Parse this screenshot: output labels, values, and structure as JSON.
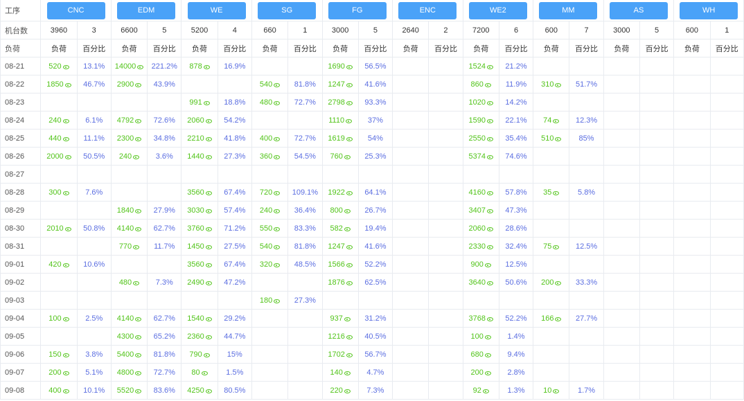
{
  "corner_label": "工序",
  "machines_label": "机台数",
  "load_label": "负荷",
  "sub_load": "负荷",
  "sub_pct": "百分比",
  "processes": [
    {
      "name": "CNC",
      "machines": "3960",
      "count": "3"
    },
    {
      "name": "EDM",
      "machines": "6600",
      "count": "5"
    },
    {
      "name": "WE",
      "machines": "5200",
      "count": "4"
    },
    {
      "name": "SG",
      "machines": "660",
      "count": "1"
    },
    {
      "name": "FG",
      "machines": "3000",
      "count": "5"
    },
    {
      "name": "ENC",
      "machines": "2640",
      "count": "2"
    },
    {
      "name": "WE2",
      "machines": "7200",
      "count": "6"
    },
    {
      "name": "MM",
      "machines": "600",
      "count": "7"
    },
    {
      "name": "AS",
      "machines": "3000",
      "count": "5"
    },
    {
      "name": "WH",
      "machines": "600",
      "count": "1"
    }
  ],
  "rows": [
    {
      "date": "08-21",
      "cells": [
        [
          "520",
          "13.1%"
        ],
        [
          "14000",
          "221.2%"
        ],
        [
          "878",
          "16.9%"
        ],
        [
          "",
          ""
        ],
        [
          "1690",
          "56.5%"
        ],
        [
          "",
          ""
        ],
        [
          "1524",
          "21.2%"
        ],
        [
          "",
          ""
        ],
        [
          "",
          ""
        ],
        [
          "",
          ""
        ]
      ]
    },
    {
      "date": "08-22",
      "cells": [
        [
          "1850",
          "46.7%"
        ],
        [
          "2900",
          "43.9%"
        ],
        [
          "",
          ""
        ],
        [
          "540",
          "81.8%"
        ],
        [
          "1247",
          "41.6%"
        ],
        [
          "",
          ""
        ],
        [
          "860",
          "11.9%"
        ],
        [
          "310",
          "51.7%"
        ],
        [
          "",
          ""
        ],
        [
          "",
          ""
        ]
      ]
    },
    {
      "date": "08-23",
      "cells": [
        [
          "",
          ""
        ],
        [
          "",
          ""
        ],
        [
          "991",
          "18.8%"
        ],
        [
          "480",
          "72.7%"
        ],
        [
          "2798",
          "93.3%"
        ],
        [
          "",
          ""
        ],
        [
          "1020",
          "14.2%"
        ],
        [
          "",
          ""
        ],
        [
          "",
          ""
        ],
        [
          "",
          ""
        ]
      ]
    },
    {
      "date": "08-24",
      "cells": [
        [
          "240",
          "6.1%"
        ],
        [
          "4792",
          "72.6%"
        ],
        [
          "2060",
          "54.2%"
        ],
        [
          "",
          ""
        ],
        [
          "1110",
          "37%"
        ],
        [
          "",
          ""
        ],
        [
          "1590",
          "22.1%"
        ],
        [
          "74",
          "12.3%"
        ],
        [
          "",
          ""
        ],
        [
          "",
          ""
        ]
      ]
    },
    {
      "date": "08-25",
      "cells": [
        [
          "440",
          "11.1%"
        ],
        [
          "2300",
          "34.8%"
        ],
        [
          "2210",
          "41.8%"
        ],
        [
          "400",
          "72.7%"
        ],
        [
          "1619",
          "54%"
        ],
        [
          "",
          ""
        ],
        [
          "2550",
          "35.4%"
        ],
        [
          "510",
          "85%"
        ],
        [
          "",
          ""
        ],
        [
          "",
          ""
        ]
      ]
    },
    {
      "date": "08-26",
      "cells": [
        [
          "2000",
          "50.5%"
        ],
        [
          "240",
          "3.6%"
        ],
        [
          "1440",
          "27.3%"
        ],
        [
          "360",
          "54.5%"
        ],
        [
          "760",
          "25.3%"
        ],
        [
          "",
          ""
        ],
        [
          "5374",
          "74.6%"
        ],
        [
          "",
          ""
        ],
        [
          "",
          ""
        ],
        [
          "",
          ""
        ]
      ]
    },
    {
      "date": "08-27",
      "cells": [
        [
          "",
          ""
        ],
        [
          "",
          ""
        ],
        [
          "",
          ""
        ],
        [
          "",
          ""
        ],
        [
          "",
          ""
        ],
        [
          "",
          ""
        ],
        [
          "",
          ""
        ],
        [
          "",
          ""
        ],
        [
          "",
          ""
        ],
        [
          "",
          ""
        ]
      ]
    },
    {
      "date": "08-28",
      "cells": [
        [
          "300",
          "7.6%"
        ],
        [
          "",
          ""
        ],
        [
          "3560",
          "67.4%"
        ],
        [
          "720",
          "109.1%"
        ],
        [
          "1922",
          "64.1%"
        ],
        [
          "",
          ""
        ],
        [
          "4160",
          "57.8%"
        ],
        [
          "35",
          "5.8%"
        ],
        [
          "",
          ""
        ],
        [
          "",
          ""
        ]
      ]
    },
    {
      "date": "08-29",
      "cells": [
        [
          "",
          ""
        ],
        [
          "1840",
          "27.9%"
        ],
        [
          "3030",
          "57.4%"
        ],
        [
          "240",
          "36.4%"
        ],
        [
          "800",
          "26.7%"
        ],
        [
          "",
          ""
        ],
        [
          "3407",
          "47.3%"
        ],
        [
          "",
          ""
        ],
        [
          "",
          ""
        ],
        [
          "",
          ""
        ]
      ]
    },
    {
      "date": "08-30",
      "cells": [
        [
          "2010",
          "50.8%"
        ],
        [
          "4140",
          "62.7%"
        ],
        [
          "3760",
          "71.2%"
        ],
        [
          "550",
          "83.3%"
        ],
        [
          "582",
          "19.4%"
        ],
        [
          "",
          ""
        ],
        [
          "2060",
          "28.6%"
        ],
        [
          "",
          ""
        ],
        [
          "",
          ""
        ],
        [
          "",
          ""
        ]
      ]
    },
    {
      "date": "08-31",
      "cells": [
        [
          "",
          ""
        ],
        [
          "770",
          "11.7%"
        ],
        [
          "1450",
          "27.5%"
        ],
        [
          "540",
          "81.8%"
        ],
        [
          "1247",
          "41.6%"
        ],
        [
          "",
          ""
        ],
        [
          "2330",
          "32.4%"
        ],
        [
          "75",
          "12.5%"
        ],
        [
          "",
          ""
        ],
        [
          "",
          ""
        ]
      ]
    },
    {
      "date": "09-01",
      "cells": [
        [
          "420",
          "10.6%"
        ],
        [
          "",
          ""
        ],
        [
          "3560",
          "67.4%"
        ],
        [
          "320",
          "48.5%"
        ],
        [
          "1566",
          "52.2%"
        ],
        [
          "",
          ""
        ],
        [
          "900",
          "12.5%"
        ],
        [
          "",
          ""
        ],
        [
          "",
          ""
        ],
        [
          "",
          ""
        ]
      ]
    },
    {
      "date": "09-02",
      "cells": [
        [
          "",
          ""
        ],
        [
          "480",
          "7.3%"
        ],
        [
          "2490",
          "47.2%"
        ],
        [
          "",
          ""
        ],
        [
          "1876",
          "62.5%"
        ],
        [
          "",
          ""
        ],
        [
          "3640",
          "50.6%"
        ],
        [
          "200",
          "33.3%"
        ],
        [
          "",
          ""
        ],
        [
          "",
          ""
        ]
      ]
    },
    {
      "date": "09-03",
      "cells": [
        [
          "",
          ""
        ],
        [
          "",
          ""
        ],
        [
          "",
          ""
        ],
        [
          "180",
          "27.3%"
        ],
        [
          "",
          ""
        ],
        [
          "",
          ""
        ],
        [
          "",
          ""
        ],
        [
          "",
          ""
        ],
        [
          "",
          ""
        ],
        [
          "",
          ""
        ]
      ]
    },
    {
      "date": "09-04",
      "cells": [
        [
          "100",
          "2.5%"
        ],
        [
          "4140",
          "62.7%"
        ],
        [
          "1540",
          "29.2%"
        ],
        [
          "",
          ""
        ],
        [
          "937",
          "31.2%"
        ],
        [
          "",
          ""
        ],
        [
          "3768",
          "52.2%"
        ],
        [
          "166",
          "27.7%"
        ],
        [
          "",
          ""
        ],
        [
          "",
          ""
        ]
      ]
    },
    {
      "date": "09-05",
      "cells": [
        [
          "",
          ""
        ],
        [
          "4300",
          "65.2%"
        ],
        [
          "2360",
          "44.7%"
        ],
        [
          "",
          ""
        ],
        [
          "1216",
          "40.5%"
        ],
        [
          "",
          ""
        ],
        [
          "100",
          "1.4%"
        ],
        [
          "",
          ""
        ],
        [
          "",
          ""
        ],
        [
          "",
          ""
        ]
      ]
    },
    {
      "date": "09-06",
      "cells": [
        [
          "150",
          "3.8%"
        ],
        [
          "5400",
          "81.8%"
        ],
        [
          "790",
          "15%"
        ],
        [
          "",
          ""
        ],
        [
          "1702",
          "56.7%"
        ],
        [
          "",
          ""
        ],
        [
          "680",
          "9.4%"
        ],
        [
          "",
          ""
        ],
        [
          "",
          ""
        ],
        [
          "",
          ""
        ]
      ]
    },
    {
      "date": "09-07",
      "cells": [
        [
          "200",
          "5.1%"
        ],
        [
          "4800",
          "72.7%"
        ],
        [
          "80",
          "1.5%"
        ],
        [
          "",
          ""
        ],
        [
          "140",
          "4.7%"
        ],
        [
          "",
          ""
        ],
        [
          "200",
          "2.8%"
        ],
        [
          "",
          ""
        ],
        [
          "",
          ""
        ],
        [
          "",
          ""
        ]
      ]
    },
    {
      "date": "09-08",
      "cells": [
        [
          "400",
          "10.1%"
        ],
        [
          "5520",
          "83.6%"
        ],
        [
          "4250",
          "80.5%"
        ],
        [
          "",
          ""
        ],
        [
          "220",
          "7.3%"
        ],
        [
          "",
          ""
        ],
        [
          "92",
          "1.3%"
        ],
        [
          "10",
          "1.7%"
        ],
        [
          "",
          ""
        ],
        [
          "",
          ""
        ]
      ]
    }
  ]
}
